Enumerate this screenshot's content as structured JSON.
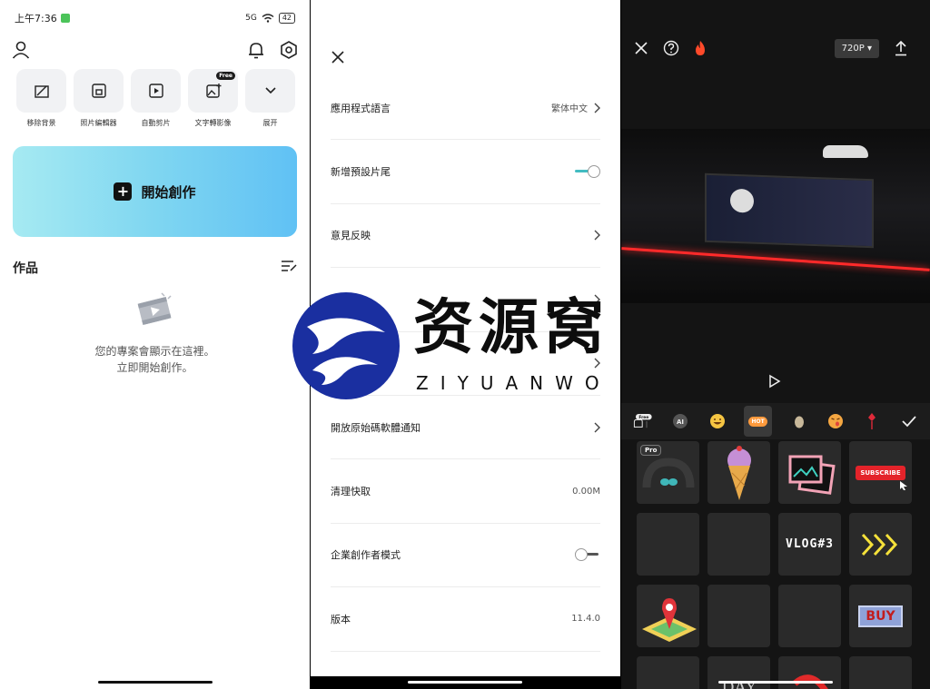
{
  "home": {
    "status": {
      "time": "上午7:36",
      "network": "5G",
      "battery": "42"
    },
    "tools": [
      {
        "label": "移除背景",
        "icon": "erase-bg-icon"
      },
      {
        "label": "照片編輯器",
        "icon": "photo-edit-icon"
      },
      {
        "label": "自動剪片",
        "icon": "auto-cut-icon"
      },
      {
        "label": "文字轉影像",
        "icon": "text-to-image-icon",
        "badge": "Free"
      },
      {
        "label": "展开",
        "icon": "chevron-down-icon"
      }
    ],
    "create_label": "開始創作",
    "works_title": "作品",
    "empty_line1": "您的專案會顯示在這裡。",
    "empty_line2": "立即開始創作。"
  },
  "settings": {
    "rows": [
      {
        "label": "應用程式語言",
        "value": "繁体中文",
        "control": "chevron"
      },
      {
        "label": "新增預設片尾",
        "value": "",
        "control": "toggle-on"
      },
      {
        "label": "意見反映",
        "value": "",
        "control": "chevron"
      },
      {
        "label": "",
        "value": "",
        "control": "chevron"
      },
      {
        "label": "",
        "value": "",
        "control": "chevron"
      },
      {
        "label": "開放原始碼軟體通知",
        "value": "",
        "control": "chevron"
      },
      {
        "label": "清理快取",
        "value": "0.00M",
        "control": "none"
      },
      {
        "label": "企業創作者模式",
        "value": "",
        "control": "toggle-off"
      },
      {
        "label": "版本",
        "value": "11.4.0",
        "control": "none"
      }
    ]
  },
  "editor": {
    "resolution": "720P",
    "tabs": [
      "free-ai-sticker",
      "ai",
      "smile-emoji",
      "hot",
      "egg",
      "tongue-emoji",
      "flower"
    ],
    "hot_label": "HOT",
    "free_label": "Free",
    "ai_label": "AI",
    "stickers": {
      "pro_label": "Pro",
      "subscribe_label": "SUBSCRIBE",
      "vlog_label": "VLOG#3",
      "buy_label": "BUY",
      "day_label": "DAY"
    }
  },
  "watermark": {
    "title": "资源窝",
    "subtitle": "ZIYUANWO"
  },
  "colors": {
    "accent_teal": "#43bcc2",
    "create_gradient_end": "#60c1f4",
    "hot_orange": "#ff9a3c"
  }
}
